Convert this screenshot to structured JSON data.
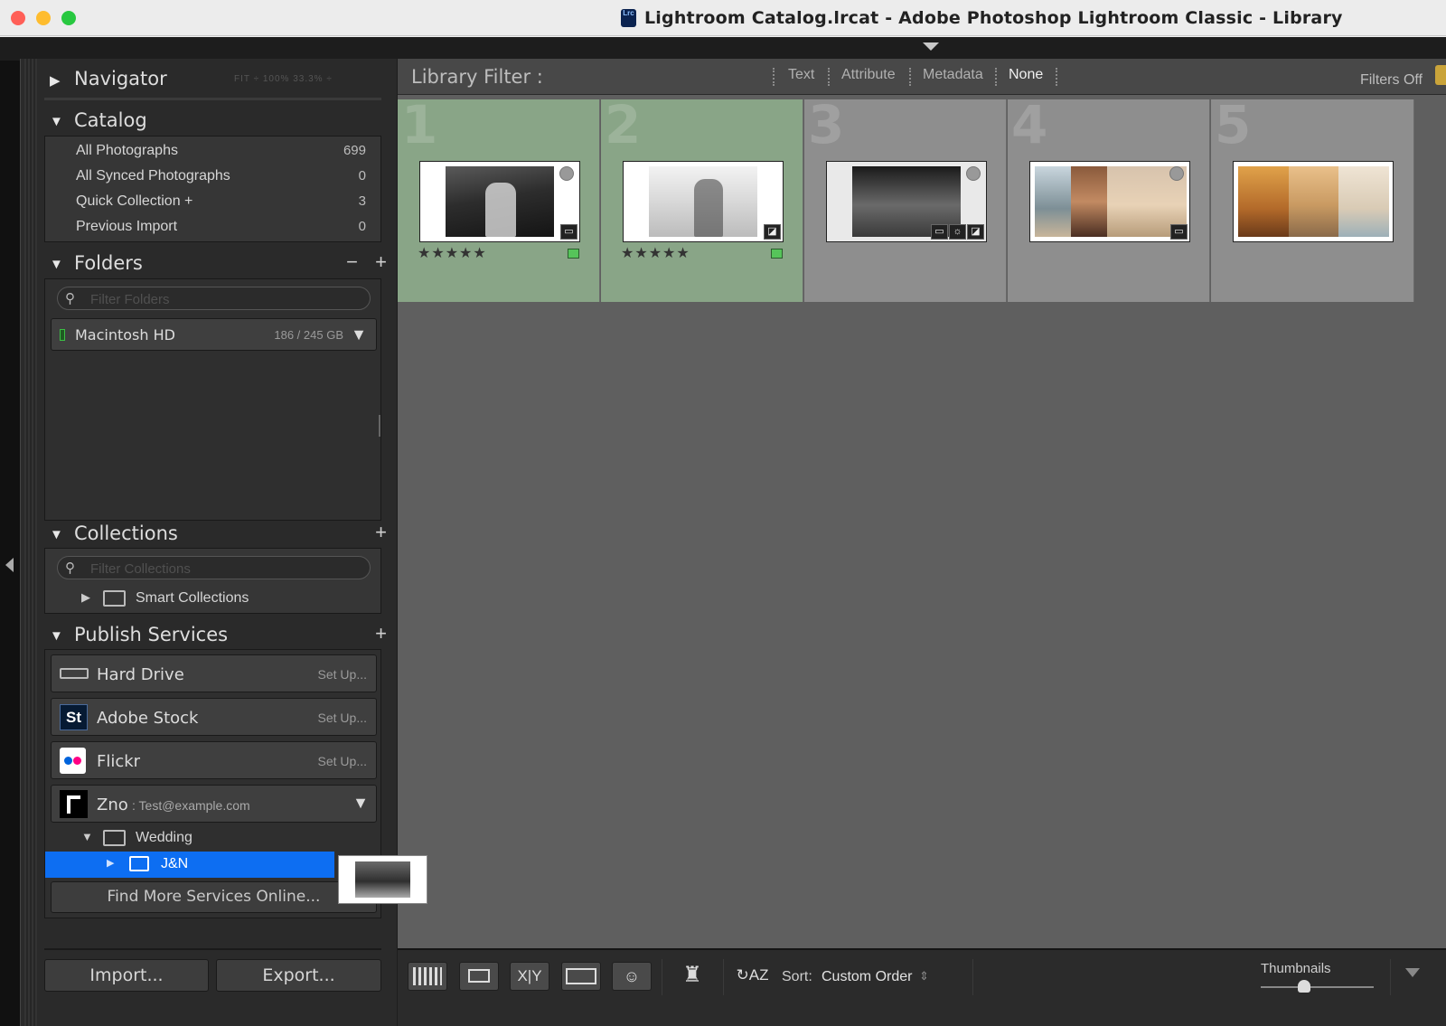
{
  "window": {
    "title": "Lightroom Catalog.lrcat - Adobe Photoshop Lightroom Classic - Library",
    "app_icon_text": "Lrc"
  },
  "left_panel": {
    "navigator": {
      "title": "Navigator",
      "presets": "FIT ÷ 100% 33.3% ÷"
    },
    "catalog": {
      "title": "Catalog",
      "items": [
        {
          "label": "All Photographs",
          "count": "699"
        },
        {
          "label": "All Synced Photographs",
          "count": "0"
        },
        {
          "label": "Quick Collection  +",
          "count": "3"
        },
        {
          "label": "Previous Import",
          "count": "0"
        }
      ]
    },
    "folders": {
      "title": "Folders",
      "search_placeholder": "Filter Folders",
      "volume": {
        "name": "Macintosh HD",
        "size": "186 / 245 GB"
      }
    },
    "collections": {
      "title": "Collections",
      "search_placeholder": "Filter Collections",
      "items": [
        {
          "label": "Smart Collections"
        }
      ]
    },
    "publish_services": {
      "title": "Publish Services",
      "services": [
        {
          "name": "Hard Drive",
          "action": "Set Up..."
        },
        {
          "name": "Adobe Stock",
          "action": "Set Up..."
        },
        {
          "name": "Flickr",
          "action": "Set Up..."
        }
      ],
      "zno": {
        "name": "Zno",
        "account": ": Test@example.com"
      },
      "tree": {
        "set_name": "Wedding",
        "collection_name": "J&N"
      },
      "find_more": "Find More Services Online..."
    },
    "import_label": "Import...",
    "export_label": "Export..."
  },
  "library_filter": {
    "label": "Library Filter :",
    "options": [
      "Text",
      "Attribute",
      "Metadata",
      "None"
    ],
    "active": "None",
    "filters_state": "Filters Off"
  },
  "grid": {
    "cells": [
      {
        "index": "1",
        "selected": true,
        "stars": "★★★★★",
        "flag": true
      },
      {
        "index": "2",
        "selected": true,
        "stars": "★★★★★",
        "flag": true
      },
      {
        "index": "3",
        "selected": false,
        "stars": "",
        "flag": false
      },
      {
        "index": "4",
        "selected": false,
        "stars": "",
        "flag": false
      },
      {
        "index": "5",
        "selected": false,
        "stars": "",
        "flag": false
      }
    ]
  },
  "toolbar": {
    "sort_label": "Sort:",
    "sort_value": "Custom Order",
    "thumbnails_label": "Thumbnails"
  },
  "colors": {
    "selection_blue": "#0d6ef2",
    "selected_cell": "#89a587",
    "flag_green": "#56c45a"
  }
}
